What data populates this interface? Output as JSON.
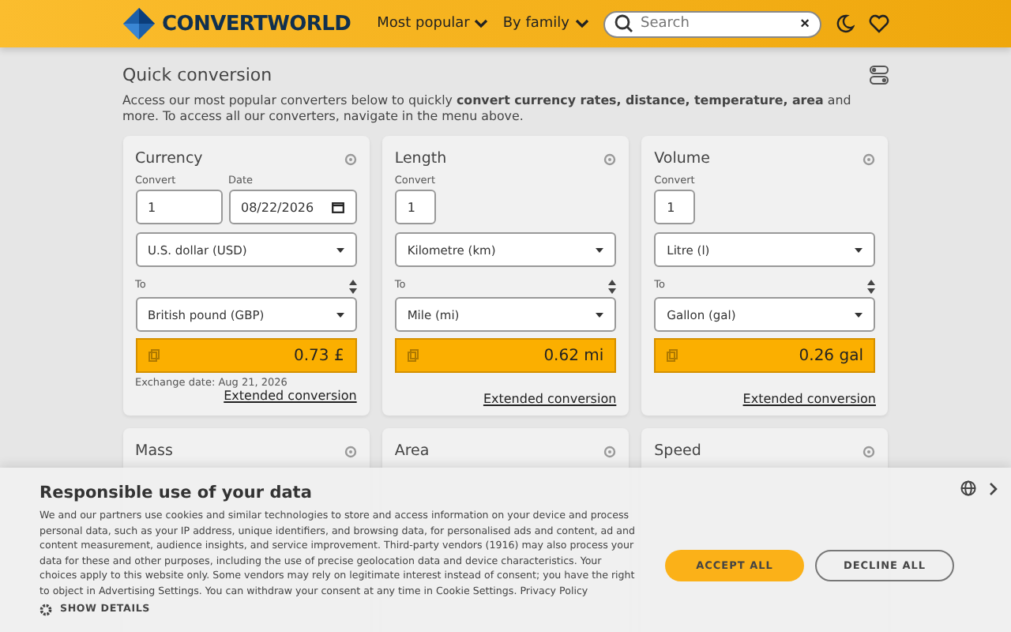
{
  "header": {
    "logo": "CONVERTWORLD",
    "nav": [
      {
        "label": "Most popular"
      },
      {
        "label": "By family"
      }
    ],
    "search": {
      "placeholder": "Search",
      "clear": "×"
    }
  },
  "intro": {
    "title": "Quick conversion",
    "text": "Access our most popular converters below to quickly **convert currency rates, distance, temperature, area** and more. To access all our converters, navigate in the menu above."
  },
  "cards": [
    {
      "kind": "full",
      "title": "Currency",
      "convert_label": "Convert",
      "value": "1",
      "date_label": "Date",
      "date": "08/22/2026",
      "from": "U.S. dollar (USD)",
      "to_label": "To",
      "to": "British pound (GBP)",
      "result": "0.73 £",
      "note": "Exchange date: Aug 21, 2026",
      "link": "Extended conversion"
    },
    {
      "kind": "full",
      "title": "Length",
      "convert_label": "Convert",
      "value": "1",
      "from": "Kilometre (km)",
      "to_label": "To",
      "to": "Mile (mi)",
      "result": "0.62 mi",
      "link": "Extended conversion"
    },
    {
      "kind": "full",
      "title": "Volume",
      "convert_label": "Convert",
      "value": "1",
      "from": "Litre (l)",
      "to_label": "To",
      "to": "Gallon (gal)",
      "result": "0.26 gal",
      "link": "Extended conversion"
    },
    {
      "kind": "partial",
      "title": "Mass"
    },
    {
      "kind": "partial",
      "title": "Area"
    },
    {
      "kind": "partial",
      "title": "Speed"
    }
  ],
  "consent": {
    "title": "Responsible use of your data",
    "text": "We and our partners use cookies and similar technologies to store and access information on your device and process personal data, such as your IP address, unique identifiers, and browsing data, for personalised ads and content, ad and content measurement, audience insights, and service improvement. Third-party vendors (1916) may also process your data for these and other purposes, including the use of precise geolocation data and device characteristics. Your choices apply to this website only. Some vendors may rely on legitimate interest instead of consent; you have the right to object in Advertising Settings. You can withdraw your consent at any time in Cookie Settings.",
    "link": "Privacy Policy",
    "details": "SHOW DETAILS",
    "buttons": [
      {
        "label": "ACCEPT ALL",
        "kind": "primary"
      },
      {
        "label": "DECLINE ALL",
        "kind": "secondary"
      }
    ]
  }
}
